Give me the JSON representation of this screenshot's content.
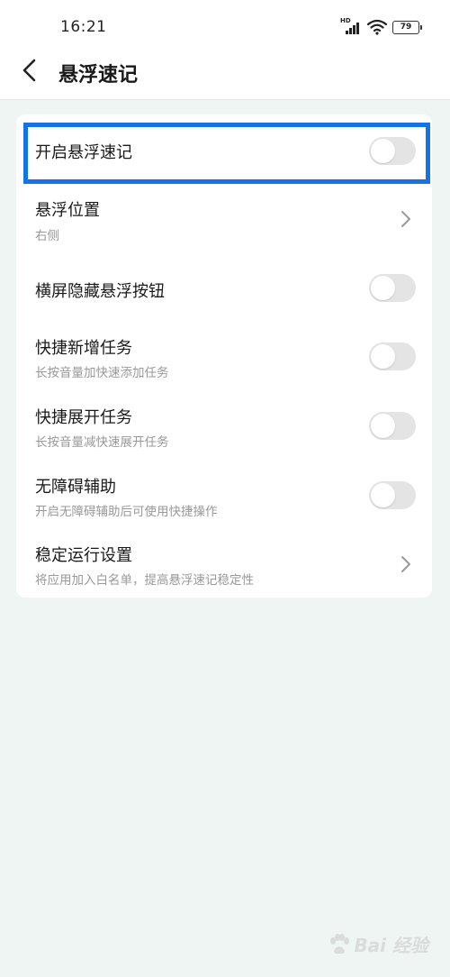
{
  "status_bar": {
    "time": "16:21",
    "network": "HD",
    "battery": "79"
  },
  "header": {
    "title": "悬浮速记"
  },
  "settings": {
    "enable_float": {
      "label": "开启悬浮速记",
      "enabled": false
    },
    "float_position": {
      "label": "悬浮位置",
      "value": "右侧"
    },
    "hide_landscape": {
      "label": "横屏隐藏悬浮按钮",
      "enabled": false
    },
    "quick_add": {
      "label": "快捷新增任务",
      "desc": "长按音量加快速添加任务",
      "enabled": false
    },
    "quick_expand": {
      "label": "快捷展开任务",
      "desc": "长按音量减快速展开任务",
      "enabled": false
    },
    "accessibility": {
      "label": "无障碍辅助",
      "desc": "开启无障碍辅助后可使用快捷操作",
      "enabled": false
    },
    "stable_run": {
      "label": "稳定运行设置",
      "desc": "将应用加入白名单，提高悬浮速记稳定性"
    }
  },
  "watermark": {
    "text": "Bai 经验"
  },
  "colors": {
    "background": "#eef5f2",
    "highlight": "#1673e6",
    "toggle_off": "#e4e4e4"
  }
}
